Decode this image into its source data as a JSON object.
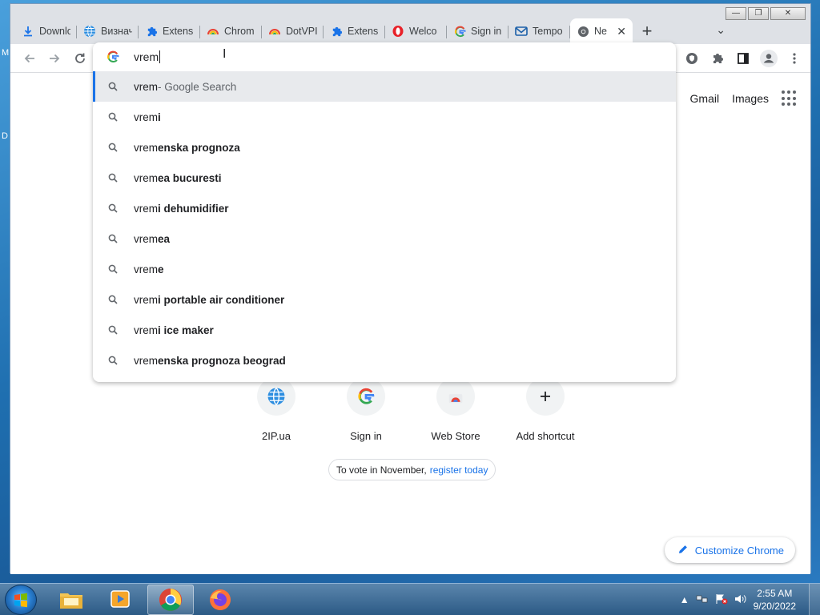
{
  "desktop": {
    "glyph_top": "M",
    "glyph_mid": "D"
  },
  "window": {
    "controls": {
      "minimize": "—",
      "maximize": "❐",
      "close": "✕"
    }
  },
  "tabs": [
    {
      "label": "Downlo",
      "icon": "download-icon"
    },
    {
      "label": "Визнач",
      "icon": "globe-icon"
    },
    {
      "label": "Extens",
      "icon": "puzzle-icon"
    },
    {
      "label": "Chrom",
      "icon": "rainbow-icon"
    },
    {
      "label": "DotVPI",
      "icon": "rainbow-icon"
    },
    {
      "label": "Extens",
      "icon": "puzzle-icon"
    },
    {
      "label": "Welco",
      "icon": "opera-icon"
    },
    {
      "label": "Sign in",
      "icon": "google-icon"
    },
    {
      "label": "Tempo",
      "icon": "mail-icon"
    },
    {
      "label": "Ne",
      "icon": "chrome-icon",
      "active": true
    }
  ],
  "toolbar": {
    "new_tab": "+",
    "tab_search": "⌄"
  },
  "omnibox": {
    "query": "vrem",
    "suggestions": [
      {
        "typed": "vrem",
        "rest": "",
        "suffix": " - Google Search"
      },
      {
        "typed": "vrem",
        "rest": "i",
        "suffix": ""
      },
      {
        "typed": "vrem",
        "rest": "enska prognoza",
        "suffix": ""
      },
      {
        "typed": "vrem",
        "rest": "ea bucuresti",
        "suffix": ""
      },
      {
        "typed": "vrem",
        "rest": "i dehumidifier",
        "suffix": ""
      },
      {
        "typed": "vrem",
        "rest": "ea",
        "suffix": ""
      },
      {
        "typed": "vrem",
        "rest": "e",
        "suffix": ""
      },
      {
        "typed": "vrem",
        "rest": "i portable air conditioner",
        "suffix": ""
      },
      {
        "typed": "vrem",
        "rest": "i ice maker",
        "suffix": ""
      },
      {
        "typed": "vrem",
        "rest": "enska prognoza beograd",
        "suffix": ""
      }
    ]
  },
  "page": {
    "gmail": "Gmail",
    "images": "Images",
    "shortcuts": [
      {
        "label": "2IP.ua",
        "icon": "globe-icon"
      },
      {
        "label": "Sign in",
        "icon": "google-icon"
      },
      {
        "label": "Web Store",
        "icon": "web-store-icon"
      },
      {
        "label": "Add shortcut",
        "icon": "plus-icon"
      }
    ],
    "promo_text": "To vote in November,",
    "promo_link": "register today",
    "customize": "Customize Chrome"
  },
  "taskbar": {
    "time": "2:55 AM",
    "date": "9/20/2022"
  },
  "colors": {
    "accent": "#1a73e8",
    "tab_strip": "#dee1e6",
    "selected_row": "#e8eaed"
  }
}
